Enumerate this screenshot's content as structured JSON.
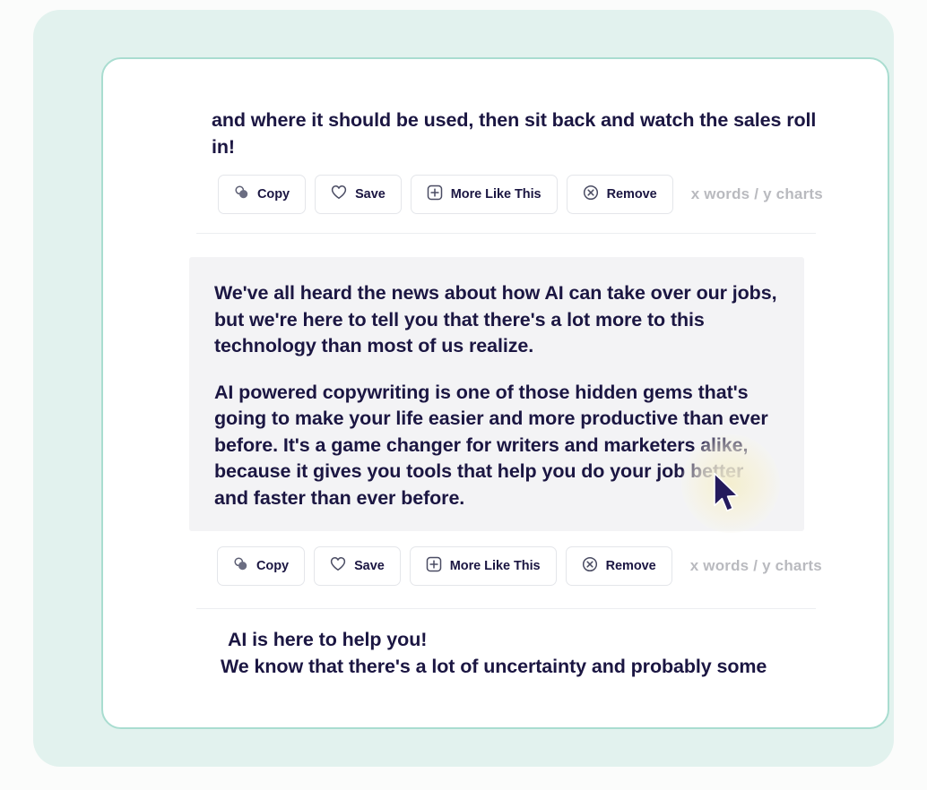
{
  "theme": {
    "page_background": "#fbfcfb",
    "panel_background": "#e2f2ee",
    "card_background": "#ffffff",
    "card_border": "#a9ddd0",
    "text_color": "#1b1642",
    "highlight_background": "#f3f3f5",
    "muted_text": "#b9babf",
    "button_border": "#e4e6ea",
    "divider": "#eceef1",
    "cursor_color": "#241a5c",
    "glow_color": "#f4eecd"
  },
  "top_paragraph": {
    "text": "and where it should be used, then sit back and watch the sales roll in!"
  },
  "action_buttons": [
    {
      "id": "copy",
      "label": "Copy",
      "icon": "copy-icon"
    },
    {
      "id": "save",
      "label": "Save",
      "icon": "heart-icon"
    },
    {
      "id": "more-like-this",
      "label": "More Like This",
      "icon": "plus-square-icon"
    },
    {
      "id": "remove",
      "label": "Remove",
      "icon": "x-circle-icon"
    }
  ],
  "meta": {
    "counter": "x words / y charts"
  },
  "highlight_block": {
    "paragraphs": [
      "We've all heard the news about how AI can take over our jobs, but we're here to tell you that there's a lot more to this technology than most of us realize.",
      "AI powered copywriting is one of those hidden gems that's going to make your life easier and more productive than ever before. It's a game changer for writers and marketers alike, because it gives you tools that help you do your job better and faster than ever before."
    ]
  },
  "bottom_paragraph": {
    "line1": "AI is here to help you!",
    "line2": "We know that there's a lot of uncertainty and probably some"
  },
  "cursor": {
    "name": "mouse-pointer"
  }
}
